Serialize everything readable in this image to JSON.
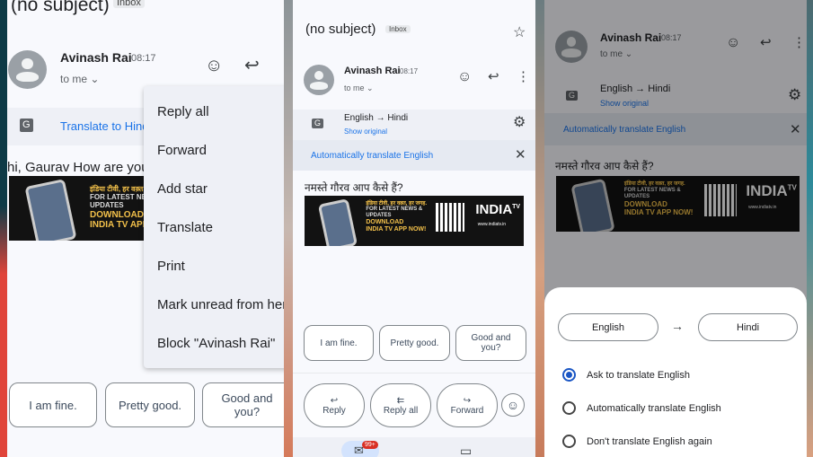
{
  "colors": {
    "link": "#1a73e8",
    "accent": "#1a56c4",
    "badge": "#d93025"
  },
  "email": {
    "subject": "(no subject)",
    "label": "Inbox",
    "sender": "Avinash Rai",
    "time": "08:17",
    "recipient": "to me",
    "body_en": "hi, Gaurav How are you",
    "body_hi": "नमस्ते गौरव आप कैसे हैं?"
  },
  "ad": {
    "hindi": "इंडिया टीवी, हर वक़्त, हर जगह.",
    "line1": "FOR LATEST NEWS &",
    "line2": "UPDATES",
    "line3": "DOWNLOAD",
    "line4": "INDIA TV APP NOW!",
    "logo": "INDIA",
    "logo_sup": "TV",
    "site": "www.indiatv.in"
  },
  "panel1": {
    "translate_link": "Translate to Hindi",
    "menu": [
      "Reply all",
      "Forward",
      "Add star",
      "Translate",
      "Print",
      "Mark unread from here",
      "Block \"Avinash Rai\""
    ]
  },
  "translation": {
    "direction": "English → Hindi",
    "show_original": "Show original",
    "auto_translate": "Automatically translate English"
  },
  "smart_replies": [
    "I am fine.",
    "Pretty good.",
    "Good and you?"
  ],
  "actions": [
    {
      "label": "Reply",
      "icon": "reply-icon"
    },
    {
      "label": "Reply all",
      "icon": "reply-all-icon"
    },
    {
      "label": "Forward",
      "icon": "forward-icon"
    }
  ],
  "nav": {
    "mail_badge": "99+"
  },
  "sheet": {
    "source": "English",
    "target": "Hindi",
    "options": [
      {
        "label": "Ask to translate English",
        "selected": true
      },
      {
        "label": "Automatically translate English",
        "selected": false
      },
      {
        "label": "Don't translate English again",
        "selected": false
      }
    ]
  }
}
